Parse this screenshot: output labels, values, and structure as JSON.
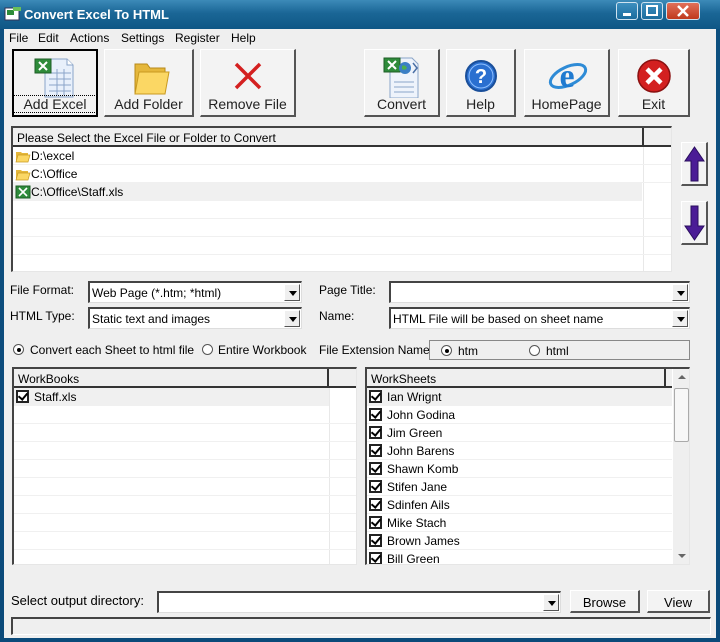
{
  "window": {
    "title": "Convert Excel To HTML",
    "controls": {
      "minimize": "_",
      "maximize": "□",
      "close": "X"
    }
  },
  "menu": [
    "File",
    "Edit",
    "Actions",
    "Settings",
    "Register",
    "Help"
  ],
  "toolbar": [
    {
      "label": "Add Excel",
      "icon": "excel-file-icon",
      "active": true
    },
    {
      "label": "Add Folder",
      "icon": "folder-icon"
    },
    {
      "label": "Remove File",
      "icon": "red-x-icon"
    },
    {
      "label": "Convert",
      "icon": "convert-icon"
    },
    {
      "label": "Help",
      "icon": "help-icon"
    },
    {
      "label": "HomePage",
      "icon": "ie-icon"
    },
    {
      "label": "Exit",
      "icon": "exit-icon"
    }
  ],
  "file_list": {
    "header": "Please Select the Excel File or Folder to Convert",
    "items": [
      {
        "type": "folder",
        "path": "D:\\excel"
      },
      {
        "type": "folder",
        "path": "C:\\Office"
      },
      {
        "type": "excel",
        "path": "C:\\Office\\Staff.xls",
        "selected": true
      }
    ]
  },
  "options": {
    "file_format_label": "File Format:",
    "file_format_value": "Web Page (*.htm; *html)",
    "html_type_label": "HTML Type:",
    "html_type_value": "Static text and images",
    "page_title_label": "Page Title:",
    "page_title_value": "",
    "name_label": "Name:",
    "name_value": "HTML File will be based on sheet name",
    "convert_mode": [
      {
        "label": "Convert each Sheet to html file",
        "checked": true
      },
      {
        "label": "Entire Workbook",
        "checked": false
      }
    ],
    "file_ext_label": "File Extension Name:",
    "file_ext": [
      {
        "label": "htm",
        "checked": true
      },
      {
        "label": "html",
        "checked": false
      }
    ]
  },
  "workbooks": {
    "header": "WorkBooks",
    "items": [
      {
        "name": "Staff.xls",
        "checked": true
      }
    ]
  },
  "worksheets": {
    "header": "WorkSheets",
    "items": [
      {
        "name": "Ian Wrignt",
        "checked": true
      },
      {
        "name": "John Godina",
        "checked": true
      },
      {
        "name": "Jim Green",
        "checked": true
      },
      {
        "name": "John Barens",
        "checked": true
      },
      {
        "name": "Shawn Komb",
        "checked": true
      },
      {
        "name": "Stifen Jane",
        "checked": true
      },
      {
        "name": "Sdinfen Ails",
        "checked": true
      },
      {
        "name": "Mike Stach",
        "checked": true
      },
      {
        "name": "Brown James",
        "checked": true
      },
      {
        "name": "Bill Green",
        "checked": true
      }
    ]
  },
  "output": {
    "label": "Select  output directory:",
    "value": "",
    "browse_label": "Browse",
    "view_label": "View"
  }
}
